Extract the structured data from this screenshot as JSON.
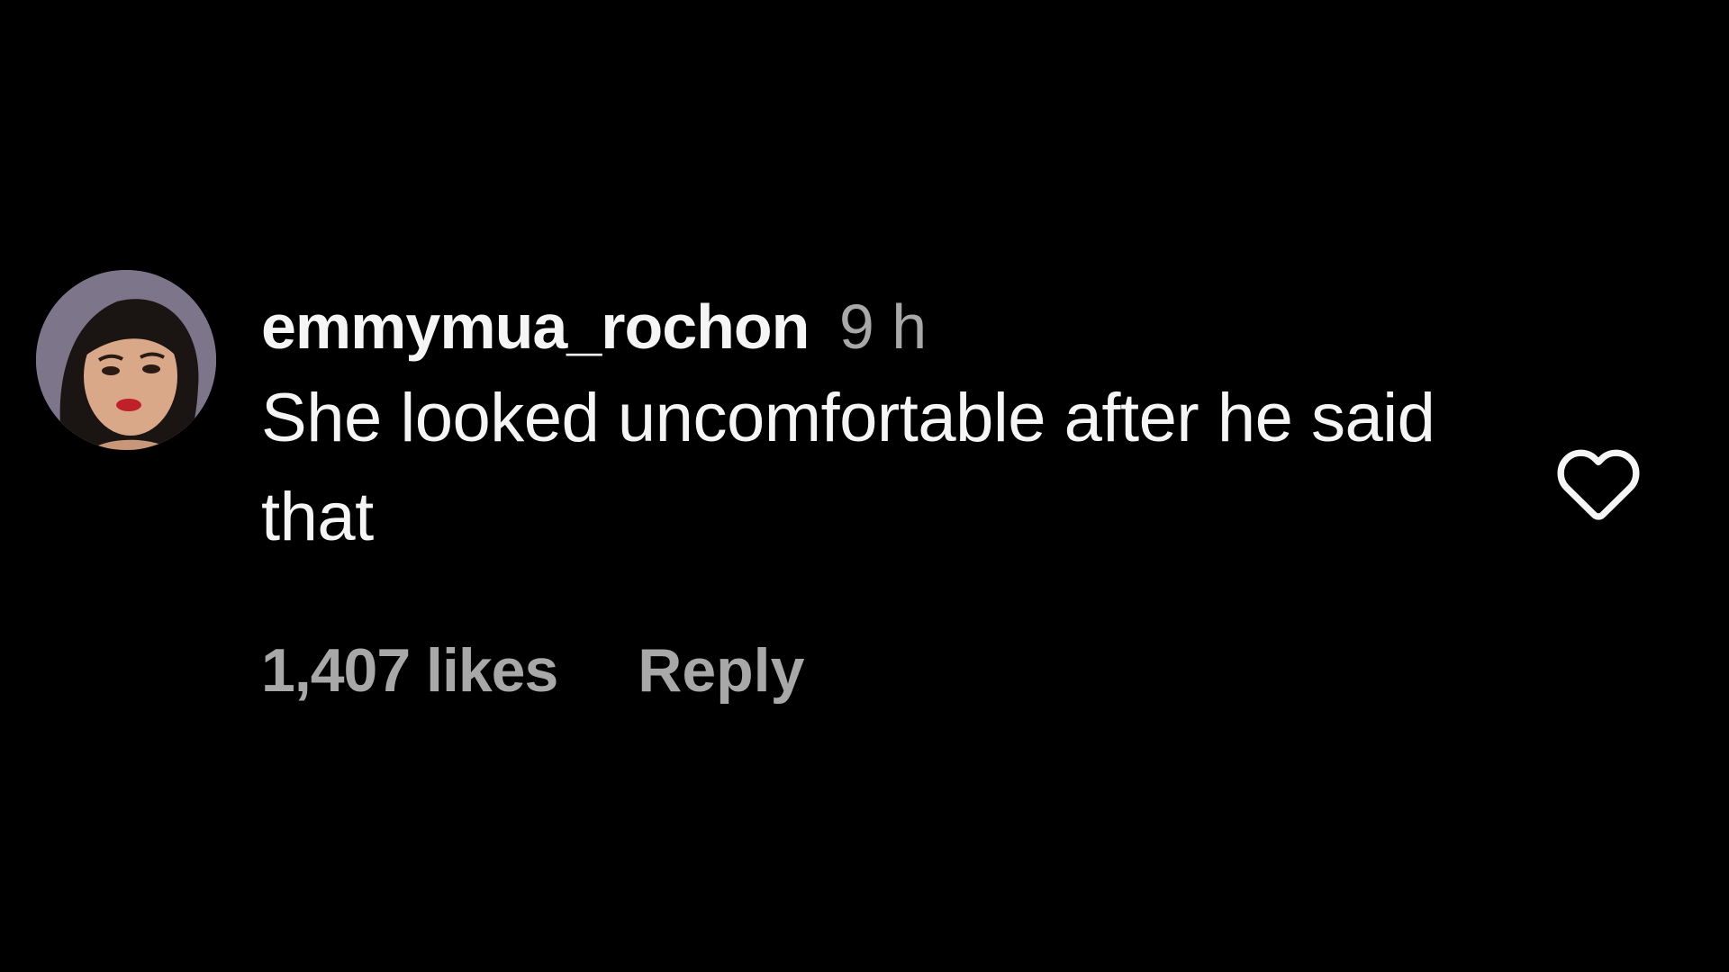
{
  "comment": {
    "username": "emmymua_rochon",
    "timestamp": "9 h",
    "text": "She looked uncomfortable after he said that",
    "likes_label": "1,407 likes",
    "reply_label": "Reply",
    "like_icon": "heart-outline-icon"
  },
  "colors": {
    "background": "#000000",
    "primary_text": "#f5f5f5",
    "secondary_text": "#a8a8a8"
  }
}
